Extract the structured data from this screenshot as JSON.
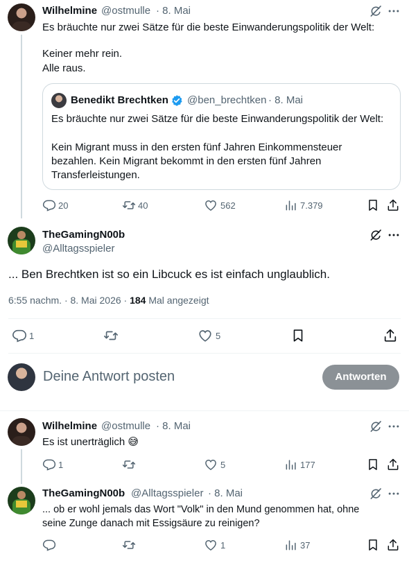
{
  "tweet1": {
    "name": "Wilhelmine",
    "handle": "@ostmulle",
    "date": "· 8. Mai",
    "lines": [
      "Es bräuchte nur zwei Sätze für die beste Einwanderungspolitik der Welt:",
      "Keiner mehr rein.",
      "Alle raus."
    ],
    "quote": {
      "name": "Benedikt Brechtken",
      "handle": "@ben_brechtken",
      "date": "· 8. Mai",
      "lines": [
        "Es bräuchte nur zwei Sätze für die beste Einwanderungspolitik der Welt:",
        "Kein Migrant muss in den ersten fünf Jahren Einkommensteuer",
        "bezahlen. Kein Migrant bekommt in den ersten fünf Jahren",
        "Transferleistungen."
      ]
    },
    "stats": {
      "replies": "20",
      "reposts": "40",
      "likes": "562",
      "views": "7.379"
    }
  },
  "main_tweet": {
    "name": "TheGamingN00b",
    "handle": "@Alltagsspieler",
    "text": "... Ben Brechtken ist so ein Libcuck es ist einfach unglaublich.",
    "timestamp": "6:55 nachm. · 8. Mai 2026 · ",
    "views_count": "184",
    "views_label": " Mal angezeigt",
    "stats": {
      "replies": "1",
      "likes": "5"
    }
  },
  "reply_box": {
    "placeholder": "Deine Antwort posten",
    "button": "Antworten"
  },
  "reply1": {
    "name": "Wilhelmine",
    "handle": "@ostmulle",
    "date": "· 8. Mai",
    "text": "Es ist unerträglich",
    "emoji": "😅",
    "stats": {
      "replies": "1",
      "likes": "5",
      "views": "177"
    }
  },
  "reply2": {
    "name": "TheGamingN00b",
    "handle": "@Alltagsspieler",
    "date": "· 8. Mai",
    "lines": [
      "... ob er wohl jemals das Wort \"Volk\" in den Mund genommen hat, ohne",
      "seine Zunge danach mit Essigsäure zu reinigen?"
    ],
    "stats": {
      "likes": "1",
      "views": "37"
    }
  },
  "colors": {
    "verified": "#1d9bf0",
    "muted": "#536471",
    "button_bg": "#8b9196"
  }
}
